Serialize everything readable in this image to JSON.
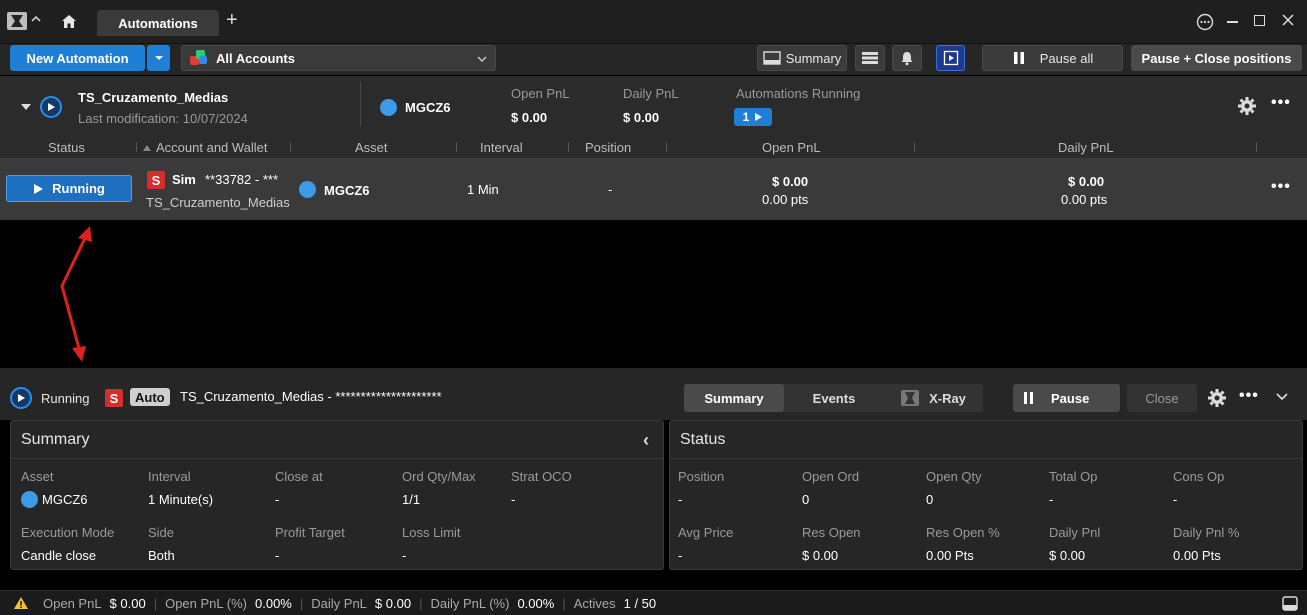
{
  "titlebar": {
    "tab_label": "Automations",
    "add_label": "+"
  },
  "toolbar": {
    "new_automation": "New Automation",
    "accounts": "All Accounts",
    "summary": "Summary",
    "pause_all": "Pause all",
    "pause_close": "Pause + Close positions"
  },
  "automation": {
    "name": "TS_Cruzamento_Medias",
    "last_mod": "Last modification: 10/07/2024",
    "asset": "MGCZ6",
    "open_pnl_label": "Open PnL",
    "open_pnl_value": "$ 0.00",
    "daily_pnl_label": "Daily PnL",
    "daily_pnl_value": "$ 0.00",
    "running_label": "Automations Running",
    "running_count": "1"
  },
  "columns": {
    "status": "Status",
    "account": "Account and Wallet",
    "asset": "Asset",
    "interval": "Interval",
    "position": "Position",
    "open_pnl": "Open PnL",
    "daily_pnl": "Daily PnL"
  },
  "row": {
    "status": "Running",
    "badge": "S",
    "account": "Sim",
    "account_masked": "**33782 - ***",
    "wallet": "TS_Cruzamento_Medias",
    "asset": "MGCZ6",
    "interval": "1 Min",
    "position": "-",
    "open_pnl": "$ 0.00",
    "open_pts": "0.00 pts",
    "daily_pnl": "$ 0.00",
    "daily_pts": "0.00 pts"
  },
  "detail": {
    "status": "Running",
    "badge": "S",
    "auto": "Auto",
    "title": "TS_Cruzamento_Medias - *********************",
    "tabs": [
      "Summary",
      "Events",
      "X-Ray"
    ],
    "pause": "Pause",
    "close": "Close"
  },
  "summary": {
    "title": "Summary",
    "collapse": "‹",
    "fields": [
      {
        "label": "Asset",
        "value": "MGCZ6"
      },
      {
        "label": "Interval",
        "value": "1 Minute(s)"
      },
      {
        "label": "Close at",
        "value": "-"
      },
      {
        "label": "Ord Qty/Max",
        "value": "1/1"
      },
      {
        "label": "Strat OCO",
        "value": "-"
      },
      {
        "label": "Execution Mode",
        "value": "Candle close"
      },
      {
        "label": "Side",
        "value": "Both"
      },
      {
        "label": "Profit Target",
        "value": "-"
      },
      {
        "label": "Loss Limit",
        "value": "-"
      }
    ]
  },
  "status_panel": {
    "title": "Status",
    "fields": [
      {
        "label": "Position",
        "value": "-"
      },
      {
        "label": "Open Ord",
        "value": "0"
      },
      {
        "label": "Open Qty",
        "value": "0"
      },
      {
        "label": "Total Op",
        "value": "-"
      },
      {
        "label": "Cons Op",
        "value": "-"
      },
      {
        "label": "Avg Price",
        "value": "-"
      },
      {
        "label": "Res Open",
        "value": "$ 0.00"
      },
      {
        "label": "Res Open %",
        "value": "0.00 Pts"
      },
      {
        "label": "Daily Pnl",
        "value": "$ 0.00"
      },
      {
        "label": "Daily Pnl %",
        "value": "0.00 Pts"
      }
    ]
  },
  "statusbar": {
    "open_pnl_label": "Open PnL",
    "open_pnl_value": "$ 0.00",
    "open_pnl_pct_label": "Open PnL (%)",
    "open_pnl_pct_value": "0.00%",
    "daily_pnl_label": "Daily PnL",
    "daily_pnl_value": "$ 0.00",
    "daily_pnl_pct_label": "Daily PnL (%)",
    "daily_pnl_pct_value": "0.00%",
    "actives_label": "Actives",
    "actives_value": "1 / 50"
  },
  "colors": {
    "accent": "#1e7fd6",
    "badge_red": "#d62c2c",
    "arrow": "#e02020"
  }
}
